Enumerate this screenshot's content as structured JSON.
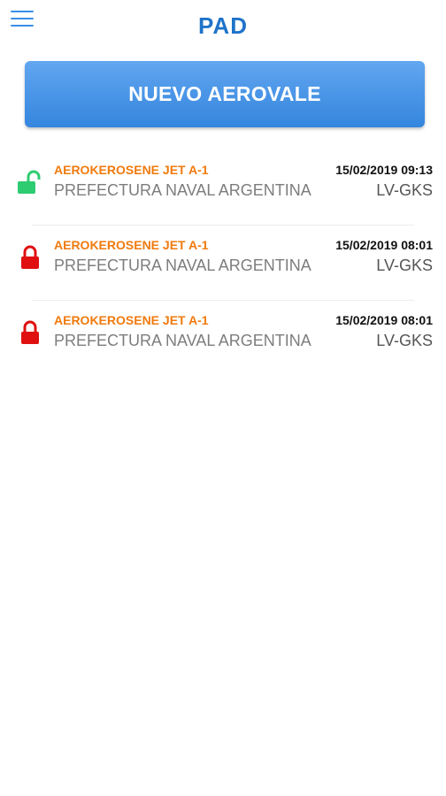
{
  "header": {
    "title": "PAD",
    "menu_icon": "hamburger-menu-icon"
  },
  "new_button": {
    "label": "NUEVO AEROVALE"
  },
  "colors": {
    "brand_blue": "#1f73c9",
    "button_blue": "#4d97e8",
    "product_orange": "#f07a0e",
    "unlocked_green": "#2ecc71",
    "locked_red": "#e01010"
  },
  "records": [
    {
      "status_icon": "unlocked-icon",
      "product": "AEROKEROSENE JET A-1",
      "organization": "PREFECTURA NAVAL ARGENTINA",
      "datetime": "15/02/2019 09:13",
      "registration": "LV-GKS"
    },
    {
      "status_icon": "locked-icon",
      "product": "AEROKEROSENE JET A-1",
      "organization": "PREFECTURA NAVAL ARGENTINA",
      "datetime": "15/02/2019 08:01",
      "registration": "LV-GKS"
    },
    {
      "status_icon": "locked-icon",
      "product": "AEROKEROSENE JET A-1",
      "organization": "PREFECTURA NAVAL ARGENTINA",
      "datetime": "15/02/2019 08:01",
      "registration": "LV-GKS"
    }
  ]
}
